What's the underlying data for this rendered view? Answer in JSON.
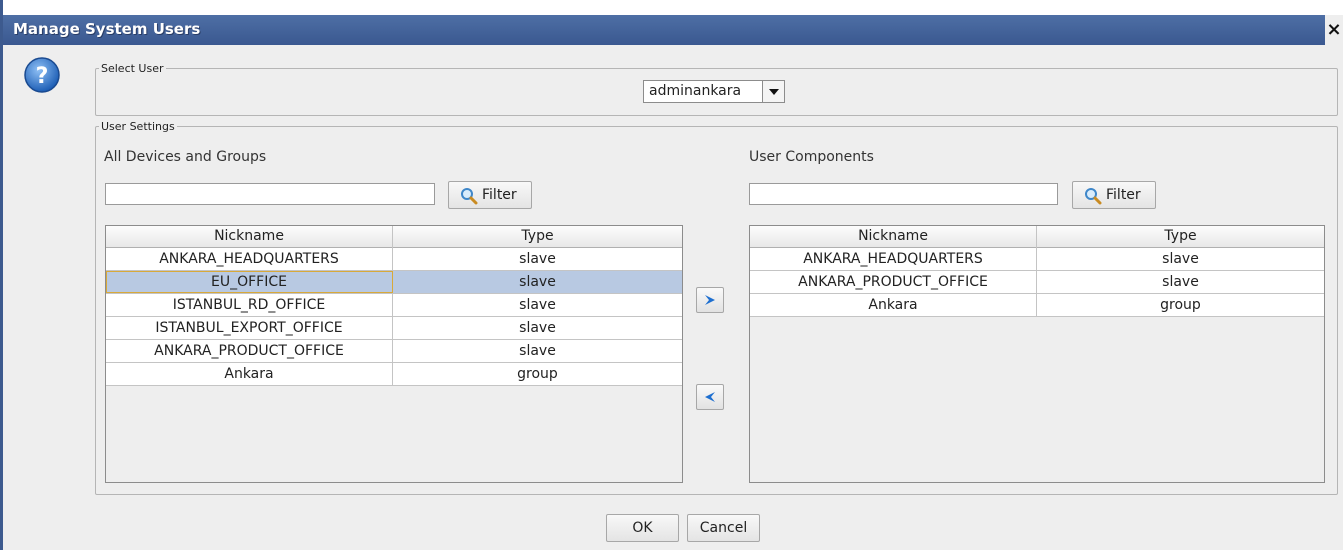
{
  "window": {
    "title": "Manage System Users",
    "close_symbol": "×"
  },
  "select_user": {
    "legend": "Select User",
    "selected": "adminankara"
  },
  "user_settings": {
    "legend": "User Settings",
    "left": {
      "title": "All Devices and Groups",
      "filter_label": "Filter",
      "filter_value": "",
      "columns": [
        "Nickname",
        "Type"
      ],
      "rows": [
        {
          "nickname": "ANKARA_HEADQUARTERS",
          "type": "slave"
        },
        {
          "nickname": "EU_OFFICE",
          "type": "slave"
        },
        {
          "nickname": "ISTANBUL_RD_OFFICE",
          "type": "slave"
        },
        {
          "nickname": "ISTANBUL_EXPORT_OFFICE",
          "type": "slave"
        },
        {
          "nickname": "ANKARA_PRODUCT_OFFICE",
          "type": "slave"
        },
        {
          "nickname": "Ankara",
          "type": "group"
        }
      ],
      "selected_row": 1
    },
    "right": {
      "title": "User Components",
      "filter_label": "Filter",
      "filter_value": "",
      "columns": [
        "Nickname",
        "Type"
      ],
      "rows": [
        {
          "nickname": "ANKARA_HEADQUARTERS",
          "type": "slave"
        },
        {
          "nickname": "ANKARA_PRODUCT_OFFICE",
          "type": "slave"
        },
        {
          "nickname": "Ankara",
          "type": "group"
        }
      ]
    }
  },
  "footer": {
    "ok_label": "OK",
    "cancel_label": "Cancel"
  },
  "icons": {
    "help": "help-icon",
    "filter": "magnifier-icon",
    "add": "arrow-right-icon",
    "remove": "arrow-left-icon"
  },
  "colors": {
    "titlebar": "#3a5890",
    "selection": "#b8c9e2",
    "arrow": "#1e6fd0"
  }
}
